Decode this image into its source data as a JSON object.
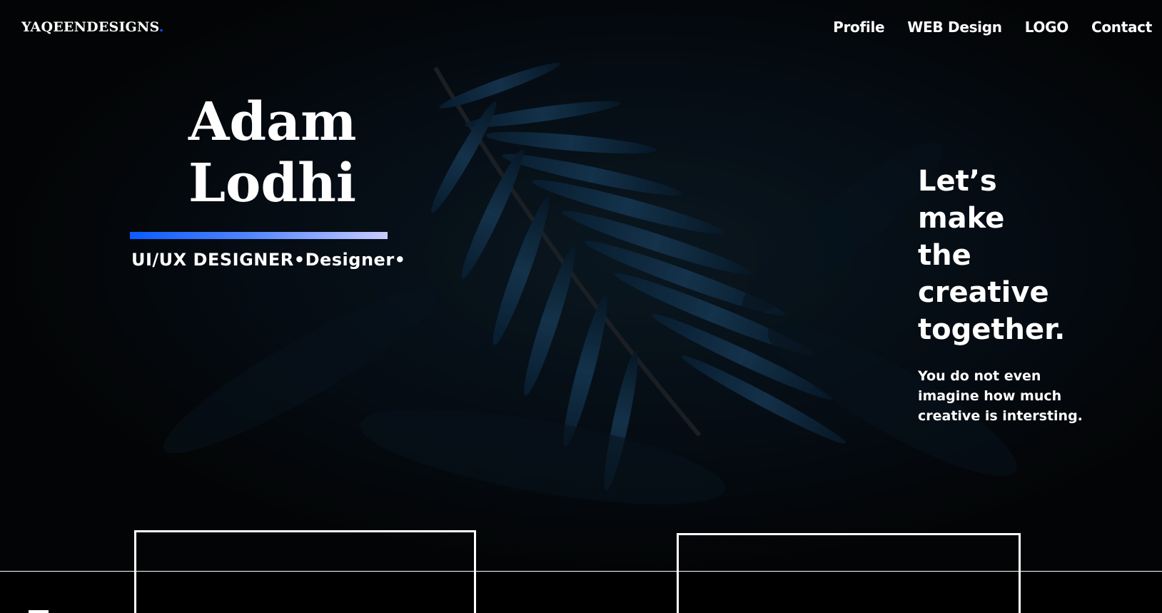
{
  "brand": {
    "logo_text": "YAQEENDESIGNS",
    "logo_dot": ".",
    "accent_color": "#1a4cff"
  },
  "nav": {
    "items": [
      {
        "label": "Profile"
      },
      {
        "label": "WEB Design"
      },
      {
        "label": "LOGO"
      },
      {
        "label": "Contact"
      }
    ]
  },
  "hero": {
    "first_name": "Adam",
    "last_name": "Lodhi",
    "subtitle": "UI/UX DESIGNER•Designer•",
    "bar_gradient": [
      "#0a5cff",
      "#c9ccff"
    ]
  },
  "tagline": {
    "lines": [
      "Let’s",
      "make",
      "the",
      "creative",
      "together."
    ],
    "sub_lines": [
      "You do not even",
      "imagine how much",
      "creative is intersting."
    ]
  },
  "colors": {
    "background": "#050607",
    "text": "#ffffff"
  }
}
